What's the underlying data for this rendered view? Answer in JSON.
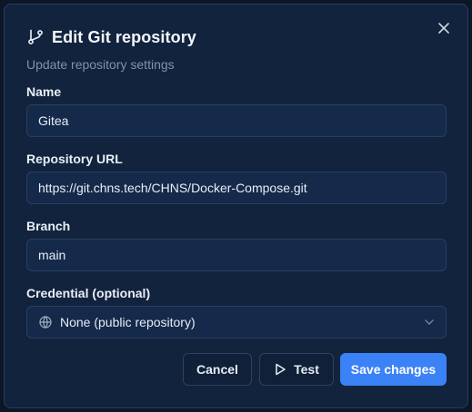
{
  "dialog": {
    "title": "Edit Git repository",
    "subtitle": "Update repository settings",
    "icons": {
      "title": "git-branch-icon",
      "close": "close-icon"
    }
  },
  "form": {
    "name": {
      "label": "Name",
      "value": "Gitea"
    },
    "url": {
      "label": "Repository URL",
      "value": "https://git.chns.tech/CHNS/Docker-Compose.git"
    },
    "branch": {
      "label": "Branch",
      "value": "main"
    },
    "credential": {
      "label": "Credential (optional)",
      "selected": "None (public repository)",
      "icon": "globe-icon",
      "chevron": "chevron-down-icon"
    }
  },
  "actions": {
    "cancel": "Cancel",
    "test": "Test",
    "test_icon": "play-icon",
    "save": "Save changes"
  },
  "colors": {
    "dialog_bg": "#11233d",
    "input_bg": "#15294a",
    "primary": "#3b82f6",
    "muted_text": "#8193ab"
  }
}
